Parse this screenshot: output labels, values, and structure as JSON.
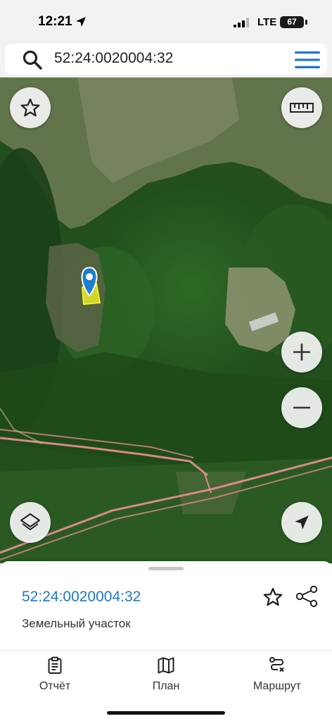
{
  "status_bar": {
    "time": "12:21",
    "network": "LTE",
    "battery": "67"
  },
  "search": {
    "query": "52:24:0020004:32",
    "icon": "search-icon",
    "menu_icon": "hamburger-menu-icon"
  },
  "map": {
    "type": "satellite",
    "marker_color": "#1f7fcf",
    "parcel_color": "#f2f224",
    "road_color": "#e08a8a",
    "buttons": {
      "favorite": "star-icon",
      "ruler": "ruler-icon",
      "zoom_in": "plus-icon",
      "zoom_out": "minus-icon",
      "layers": "layers-icon",
      "locate": "navigation-arrow-icon"
    }
  },
  "sheet": {
    "parcel_id": "52:24:0020004:32",
    "parcel_type": "Земельный участок",
    "accent": "#1f78c8"
  },
  "tabs": [
    {
      "label": "Отчёт",
      "icon": "report-icon"
    },
    {
      "label": "План",
      "icon": "map-plan-icon"
    },
    {
      "label": "Маршрут",
      "icon": "route-icon"
    }
  ]
}
